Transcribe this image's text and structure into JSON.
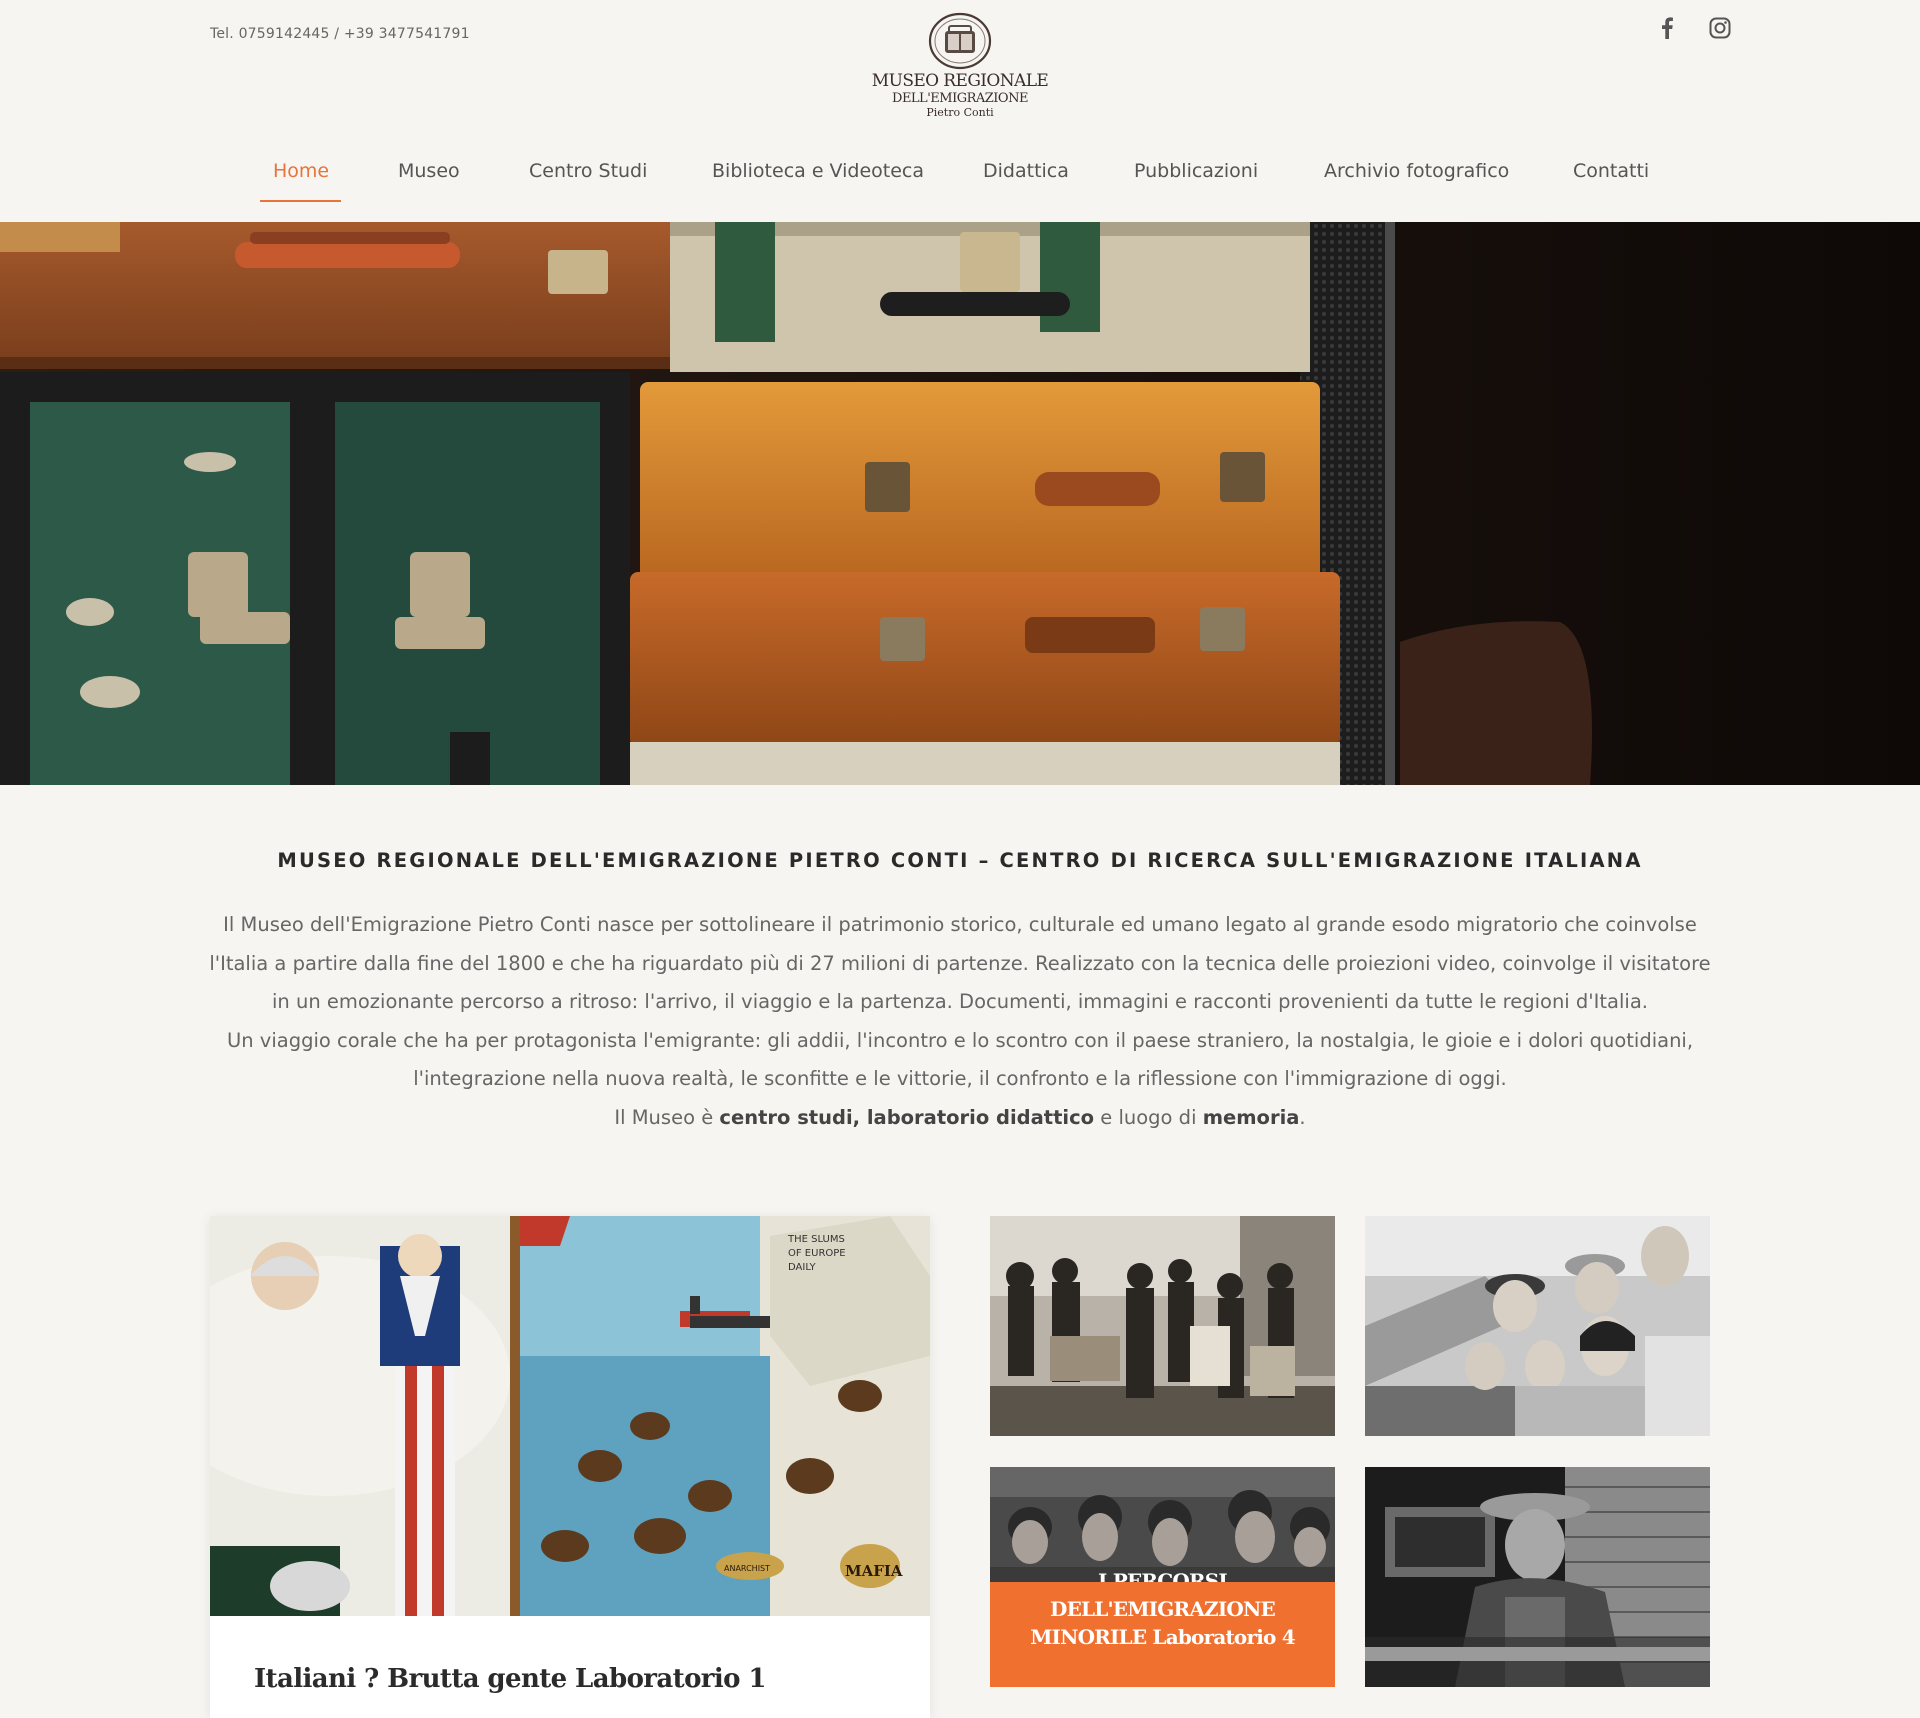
{
  "header": {
    "phone": "Tel. 0759142445  / +39 3477541791",
    "logo": {
      "line1": "MUSEO REGIONALE",
      "line2": "DELL'EMIGRAZIONE",
      "line3": "Pietro Conti"
    },
    "social": [
      "facebook-icon",
      "instagram-icon"
    ]
  },
  "nav": {
    "items": [
      {
        "label": "Home",
        "active": true
      },
      {
        "label": "Museo"
      },
      {
        "label": "Centro Studi"
      },
      {
        "label": "Biblioteca e Videoteca"
      },
      {
        "label": "Didattica"
      },
      {
        "label": "Pubblicazioni"
      },
      {
        "label": "Archivio fotografico"
      },
      {
        "label": "Contatti"
      }
    ]
  },
  "intro": {
    "title": "MUSEO REGIONALE DELL'EMIGRAZIONE PIETRO CONTI – CENTRO DI RICERCA SULL'EMIGRAZIONE ITALIANA",
    "p1": "Il Museo dell'Emigrazione Pietro Conti nasce per sottolineare il patrimonio storico, culturale ed umano legato al grande esodo migratorio che coinvolse l'Italia a partire dalla fine del 1800 e che ha riguardato più di 27 milioni di partenze. Realizzato con la tecnica delle proiezioni video, coinvolge il visitatore in un emozionante percorso a ritroso: l'arrivo, il viaggio e la partenza. Documenti, immagini e racconti provenienti da tutte le regioni d'Italia.",
    "p2": "Un viaggio corale che ha per protagonista l'emigrante: gli addii, l'incontro e lo scontro con il paese straniero, la nostalgia, le gioie e i dolori quotidiani, l'integrazione nella nuova realtà, le sconfitte e le vittorie, il confronto e la riflessione con l'immigrazione di oggi.",
    "p3_pre": "Il Museo è ",
    "p3_bold1": "centro studi, laboratorio didattico",
    "p3_mid": " e luogo di ",
    "p3_bold2": "memoria",
    "p3_end": "."
  },
  "cards": {
    "big_title": "Italiani ? Brutta gente Laboratorio 1",
    "big_cartoon_sign": "THE SLUMS OF EUROPE DAILY",
    "big_cartoon_labels": [
      "MAFIA",
      "ANARCHIST"
    ],
    "t3_pre": "I PERCORSI",
    "t3_line1": "DELL'EMIGRAZIONE",
    "t3_line2": "MINORILE Laboratorio 4"
  },
  "colors": {
    "accent": "#e8743b",
    "background": "#f6f5f1",
    "overlay": "#f07030"
  }
}
